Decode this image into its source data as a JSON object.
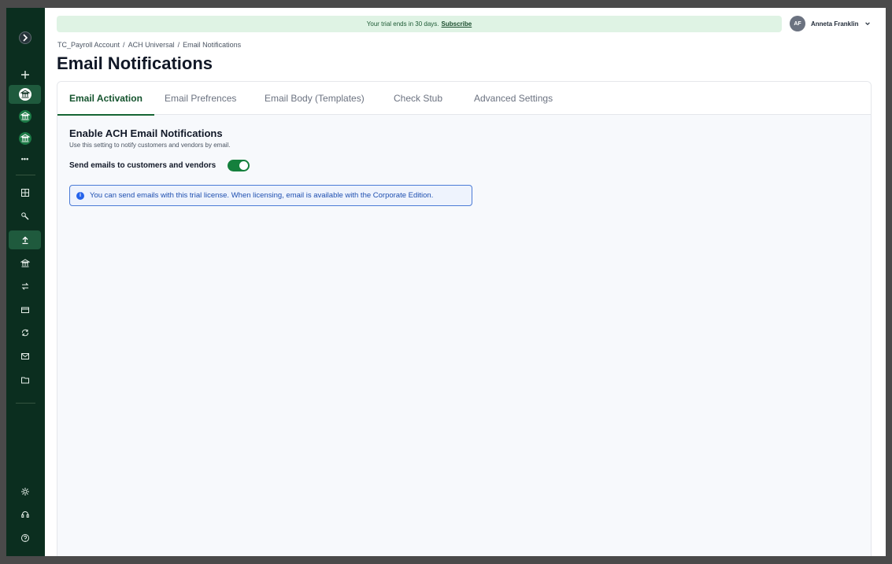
{
  "banner": {
    "text": "Your trial ends in 30 days.",
    "link": "Subscribe"
  },
  "user": {
    "initials": "AF",
    "name": "Anneta Franklin"
  },
  "breadcrumb": [
    "TC_Payroll Account",
    "ACH Universal",
    "Email Notifications"
  ],
  "breadcrumb_sep": "/",
  "page_title": "Email Notifications",
  "tabs": [
    {
      "label": "Email Activation",
      "active": true
    },
    {
      "label": "Email Prefrences",
      "active": false
    },
    {
      "label": "Email Body (Templates)",
      "active": false
    },
    {
      "label": "Check Stub",
      "active": false
    },
    {
      "label": "Advanced Settings",
      "active": false
    }
  ],
  "section": {
    "title": "Enable ACH Email Notifications",
    "description": "Use this setting to notify customers and vendors by email.",
    "toggle_label": "Send emails to customers and vendors",
    "toggle_on": true
  },
  "info": {
    "icon": "i",
    "text": "You can send emails with this trial license. When licensing, email is available with the Corporate Edition."
  },
  "sidebar": {
    "icons": [
      "chevron-right-icon",
      "plus-icon",
      "bank-icon",
      "bank-icon",
      "bank-icon",
      "more-icon",
      "dashboard-icon",
      "wrench-icon",
      "upload-icon",
      "bank-icon",
      "transfer-icon",
      "card-icon",
      "sync-icon",
      "mail-icon",
      "folder-icon",
      "settings-icon",
      "headset-icon",
      "help-icon"
    ],
    "more_label": "•••"
  },
  "colors": {
    "sidebar_bg": "#0b2e1f",
    "accent": "#166534",
    "banner_bg": "#dff3e4",
    "info_border": "#4b7bd6"
  }
}
